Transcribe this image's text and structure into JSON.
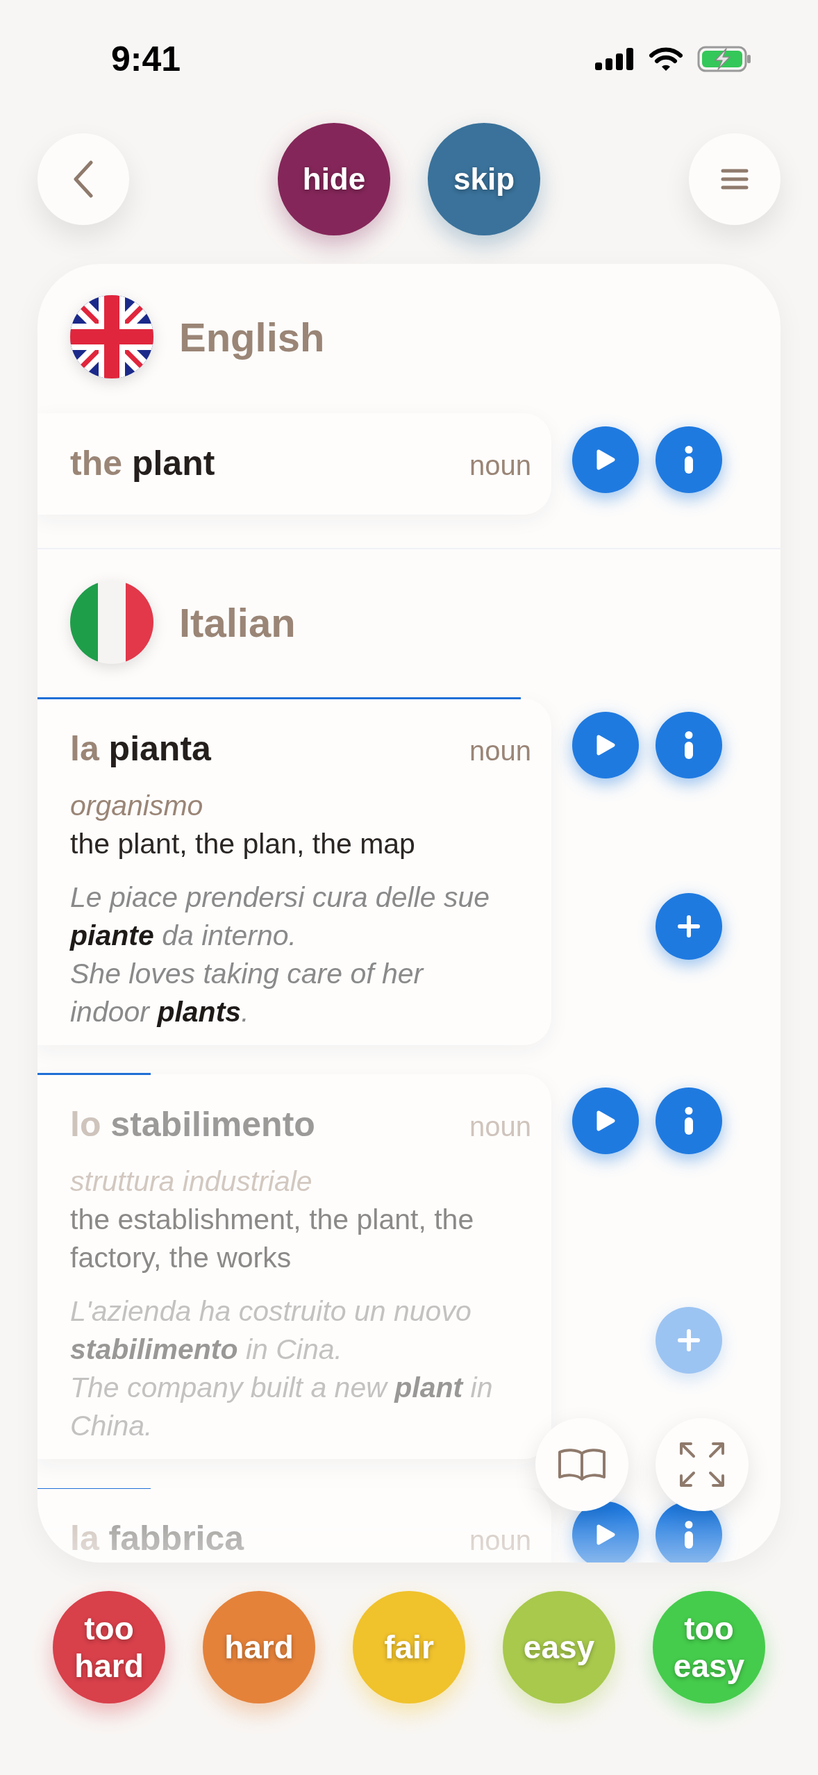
{
  "status_bar": {
    "time": "9:41"
  },
  "top_bar": {
    "buttons": [
      {
        "label": "hide",
        "color": "#842659"
      },
      {
        "label": "skip",
        "color": "#3a729b"
      }
    ]
  },
  "sections": [
    {
      "language": "English",
      "kind": "uk",
      "entries": [
        {
          "article": "the",
          "word": "plant",
          "pos": "noun",
          "dimmed": false
        }
      ]
    },
    {
      "language": "Italian",
      "kind": "it",
      "entries": [
        {
          "article": "la",
          "word": "pianta",
          "pos": "noun",
          "level": 0.94,
          "dimmed": false,
          "sense": "organismo",
          "translation": "the plant, the plan, the map",
          "example": "Le piace prendersi cura delle sue **piante** da interno.",
          "example_translation": "She loves taking care of her indoor **plants**."
        },
        {
          "article": "lo",
          "word": "stabilimento",
          "pos": "noun",
          "level": 0.22,
          "dimmed": true,
          "sense": "struttura industriale",
          "translation": "the establishment, the plant, the factory, the works",
          "example": "L'azienda ha costruito un nuovo **stabilimento** in Cina.",
          "example_translation": "The company built a new **plant** in China."
        },
        {
          "article": "la",
          "word": "fabbrica",
          "pos": "noun",
          "level": 0.22,
          "dimmed": true
        }
      ]
    }
  ],
  "ratings": [
    {
      "label": "too hard",
      "color": "#d8404a"
    },
    {
      "label": "hard",
      "color": "#e4823a"
    },
    {
      "label": "fair",
      "color": "#f0c22c"
    },
    {
      "label": "easy",
      "color": "#a8c94c"
    },
    {
      "label": "too easy",
      "color": "#45cc4c"
    }
  ]
}
